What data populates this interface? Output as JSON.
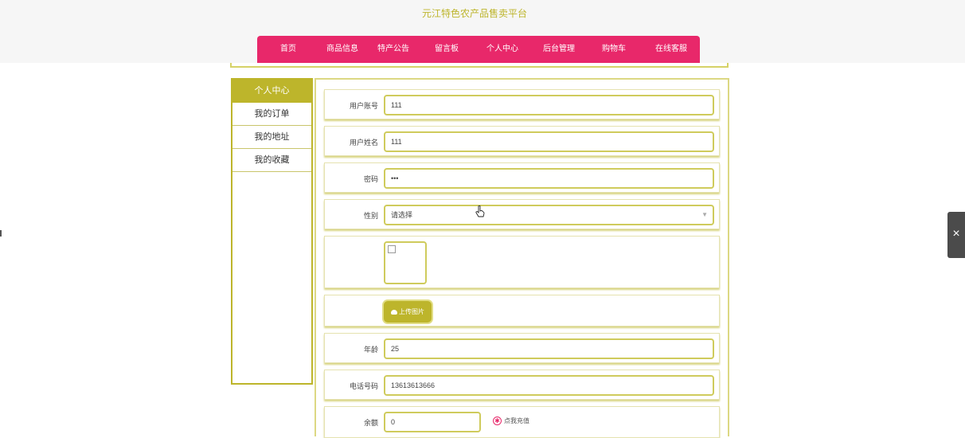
{
  "site": {
    "title": "元江特色农产品售卖平台"
  },
  "nav": [
    {
      "label": "首页"
    },
    {
      "label": "商品信息"
    },
    {
      "label": "特产公告"
    },
    {
      "label": "留言板"
    },
    {
      "label": "个人中心"
    },
    {
      "label": "后台管理"
    },
    {
      "label": "购物车"
    },
    {
      "label": "在线客服"
    }
  ],
  "sidebar": {
    "items": [
      {
        "label": "个人中心",
        "active": true
      },
      {
        "label": "我的订单"
      },
      {
        "label": "我的地址"
      },
      {
        "label": "我的收藏"
      }
    ]
  },
  "form": {
    "account": {
      "label": "用户账号",
      "value": "111"
    },
    "name": {
      "label": "用户姓名",
      "value": "111"
    },
    "password": {
      "label": "密码",
      "value": "•••"
    },
    "gender": {
      "label": "性别",
      "value": "请选择"
    },
    "upload_label": "上传图片",
    "age": {
      "label": "年龄",
      "value": "25"
    },
    "phone": {
      "label": "电话号码",
      "value": "13613613666"
    },
    "balance": {
      "label": "余额",
      "value": "0"
    },
    "recharge_label": "点我充值"
  },
  "icons": {
    "upload": "cloud-upload-icon",
    "recharge": "recharge-icon",
    "cursor": "hand-pointer-icon",
    "toggle": "close-icon"
  },
  "colors": {
    "accent": "#bdb52b",
    "nav": "#e8286a"
  }
}
